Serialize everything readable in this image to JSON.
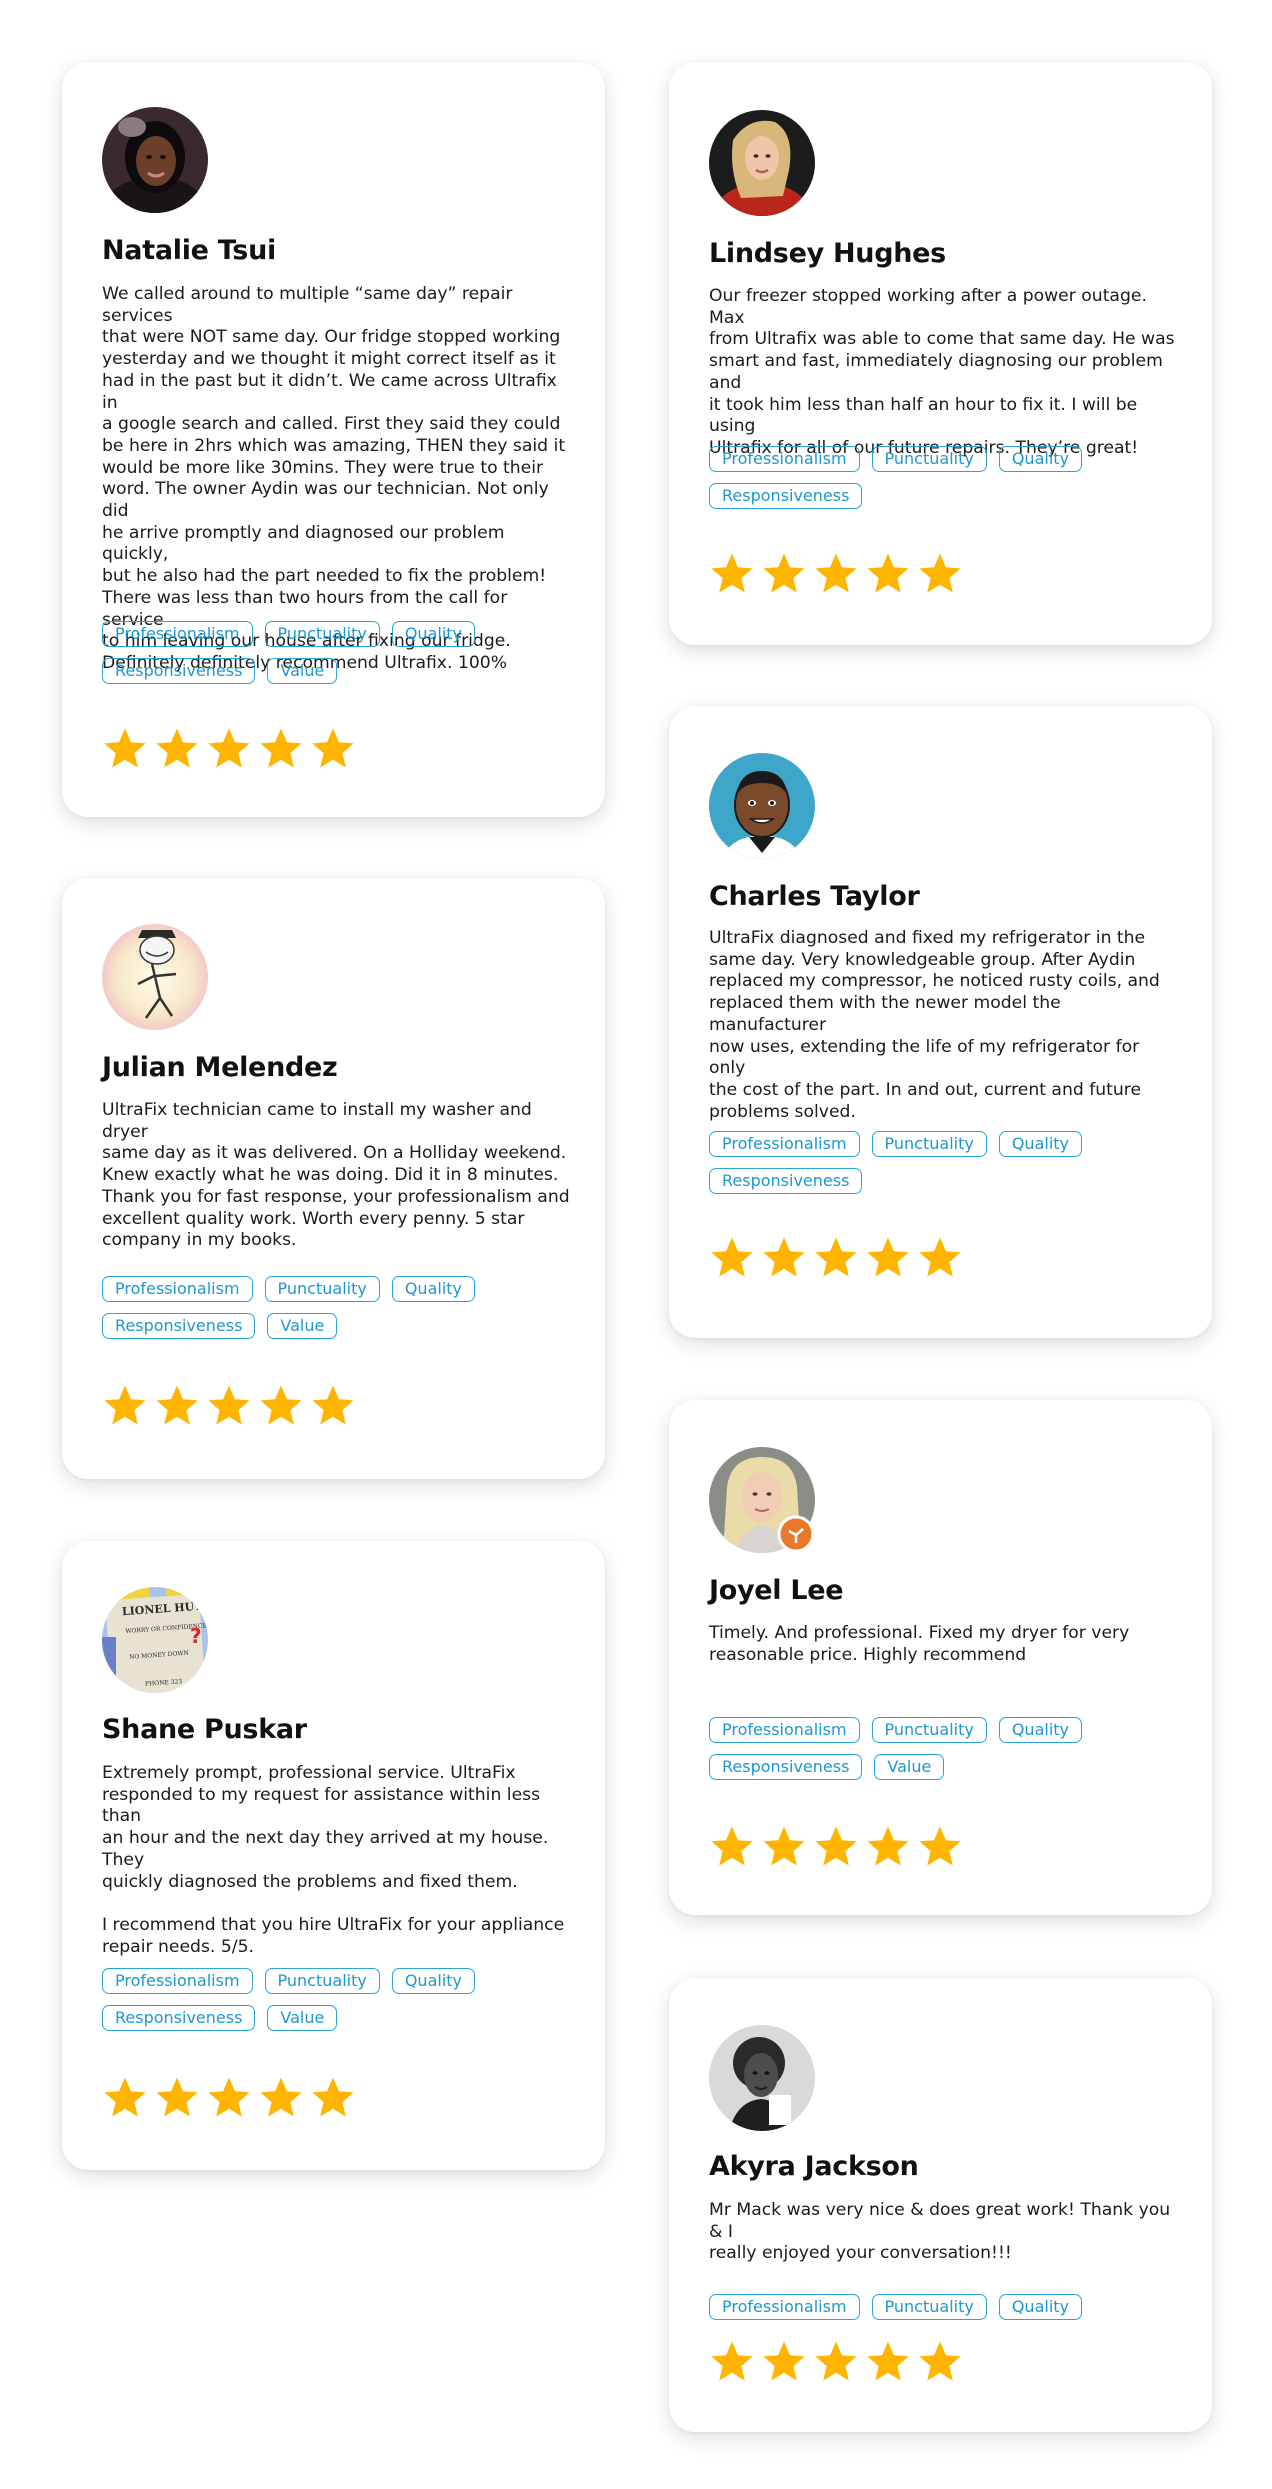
{
  "colors": {
    "star": "#FFB500",
    "tag_border": "#2AA3DB",
    "tag_text": "#1D97D0"
  },
  "reviews": [
    {
      "name": "Natalie Tsui",
      "avatar": "avatar-photo-woman",
      "text": "We called around to multiple “same day” repair services\nthat were NOT same day. Our fridge stopped working\nyesterday and we thought it might correct itself as it\nhad in the past but it didn’t. We came across Ultrafix in\na google search and called. First they said they could\nbe here in 2hrs which was amazing, THEN they said it\nwould be more like 30mins. They were true to their\nword. The owner Aydin was our technician. Not only did\nhe arrive promptly and diagnosed our problem quickly,\nbut he also had the part needed to fix the problem!\nThere was less than two hours from the call for service\nto him leaving our house after fixing our fridge.\nDefinitely definitely recommend Ultrafix. 100%",
      "tags": [
        "Professionalism",
        "Punctuality",
        "Quality",
        "Responsiveness",
        "Value"
      ],
      "rating": 5
    },
    {
      "name": "Lindsey Hughes",
      "avatar": "avatar-photo-woman",
      "text": "Our freezer stopped working after a power outage.  Max\nfrom Ultrafix was able to come that same day.  He was\nsmart and fast, immediately diagnosing our problem and\nit took him less than half an hour to fix it.  I will be using\nUltrafix for all of our future repairs.  They’re great!",
      "tags": [
        "Professionalism",
        "Punctuality",
        "Quality",
        "Responsiveness"
      ],
      "rating": 5
    },
    {
      "name": "Charles Taylor",
      "avatar": "avatar-cartoon-man",
      "text": "UltraFix diagnosed and fixed my refrigerator in the\nsame day. Very knowledgeable group. After Aydin\nreplaced my compressor, he noticed rusty coils, and\nreplaced them with the newer model the manufacturer\nnow uses, extending the life of my refrigerator for only\nthe cost of the part. In and out, current and future\nproblems solved.",
      "tags": [
        "Professionalism",
        "Punctuality",
        "Quality",
        "Responsiveness"
      ],
      "rating": 5
    },
    {
      "name": "Julian Melendez",
      "avatar": "avatar-meme-drawing",
      "text": "UltraFix technician came to install my washer and dryer\nsame day as it was delivered. On a Holliday weekend.\nKnew exactly what he was doing. Did it in 8 minutes.\nThank you for fast response, your professionalism and\nexcellent quality work. Worth every penny. 5 star\ncompany in my books.",
      "tags": [
        "Professionalism",
        "Punctuality",
        "Quality",
        "Responsiveness",
        "Value"
      ],
      "rating": 5
    },
    {
      "name": "Joyel Lee",
      "avatar": "avatar-photo-woman",
      "text": "Timely. And professional. Fixed my dryer  for very\nreasonable price. Highly recommend",
      "tags": [
        "Professionalism",
        "Punctuality",
        "Quality",
        "Responsiveness",
        "Value"
      ],
      "rating": 5
    },
    {
      "name": "Shane Puskar",
      "avatar": "avatar-sign-image",
      "text": "Extremely prompt, professional service. UltraFix\nresponded to my request for assistance within less than\nan hour and the next day they arrived at my house. They\nquickly diagnosed the problems and fixed them.\n\nI recommend that you hire UltraFix for your appliance\nrepair needs. 5/5.",
      "tags": [
        "Professionalism",
        "Punctuality",
        "Quality",
        "Responsiveness",
        "Value"
      ],
      "rating": 5
    },
    {
      "name": "Akyra Jackson",
      "avatar": "avatar-photo-woman",
      "text": "Mr Mack was very nice & does great work! Thank you & I\nreally enjoyed your conversation!!!",
      "tags": [
        "Professionalism",
        "Punctuality",
        "Quality"
      ],
      "rating": 5
    }
  ],
  "avatar_texts": {
    "shane": {
      "sign_top": "LIONEL HUT",
      "sign_mid": "WORRY OR CONFIDENCE",
      "sign_low": "NO MONEY DOWN",
      "sign_bottom": "PHONE 323"
    }
  }
}
